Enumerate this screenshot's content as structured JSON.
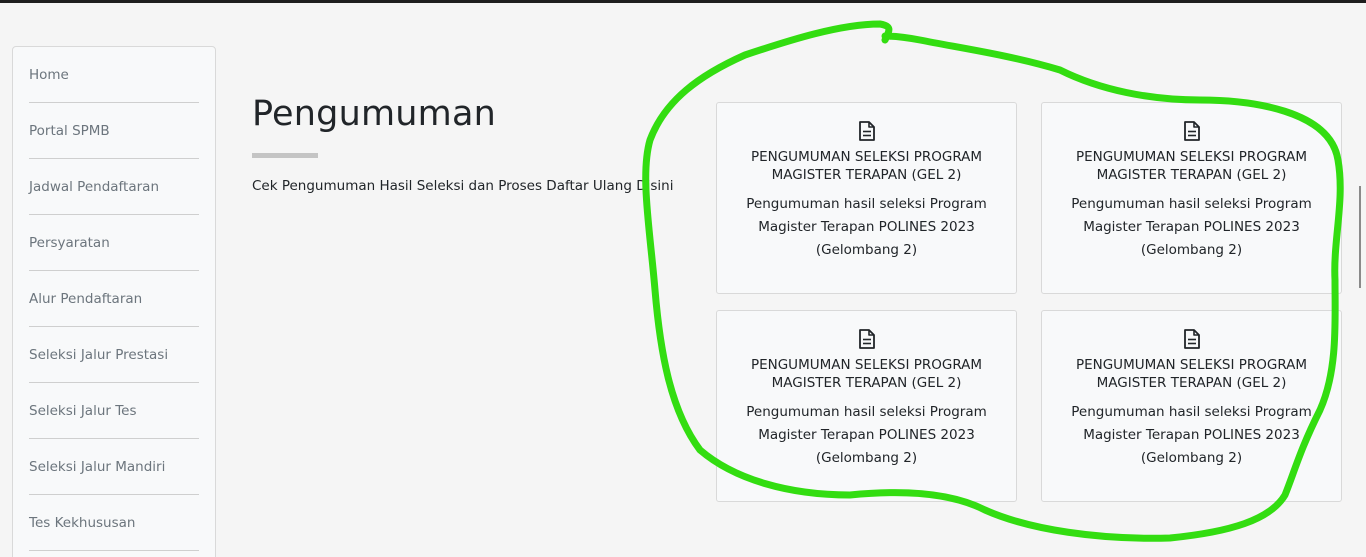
{
  "sidebar": {
    "items": [
      {
        "label": "Home"
      },
      {
        "label": "Portal SPMB"
      },
      {
        "label": "Jadwal Pendaftaran"
      },
      {
        "label": "Persyaratan"
      },
      {
        "label": "Alur Pendaftaran"
      },
      {
        "label": "Seleksi Jalur Prestasi"
      },
      {
        "label": "Seleksi Jalur Tes"
      },
      {
        "label": "Seleksi Jalur Mandiri"
      },
      {
        "label": "Tes Kekhususan"
      }
    ]
  },
  "main": {
    "title": "Pengumuman",
    "description": "Cek Pengumuman Hasil Seleksi dan Proses Daftar Ulang Disini"
  },
  "cards": [
    {
      "icon": "document-icon",
      "title": "PENGUMUMAN SELEKSI PROGRAM MAGISTER TERAPAN (GEL 2)",
      "text": "Pengumuman hasil seleksi Program Magister Terapan POLINES 2023 (Gelombang 2)"
    },
    {
      "icon": "document-icon",
      "title": "PENGUMUMAN SELEKSI PROGRAM MAGISTER TERAPAN (GEL 2)",
      "text": "Pengumuman hasil seleksi Program Magister Terapan POLINES 2023 (Gelombang 2)"
    },
    {
      "icon": "document-icon",
      "title": "PENGUMUMAN SELEKSI PROGRAM MAGISTER TERAPAN (GEL 2)",
      "text": "Pengumuman hasil seleksi Program Magister Terapan POLINES 2023 (Gelombang 2)"
    },
    {
      "icon": "document-icon",
      "title": "PENGUMUMAN SELEKSI PROGRAM MAGISTER TERAPAN (GEL 2)",
      "text": "Pengumuman hasil seleksi Program Magister Terapan POLINES 2023 (Gelombang 2)"
    }
  ],
  "colors": {
    "annotation_stroke": "#33dd11",
    "background": "#f5f5f5",
    "card_background": "#f8f9fa"
  }
}
